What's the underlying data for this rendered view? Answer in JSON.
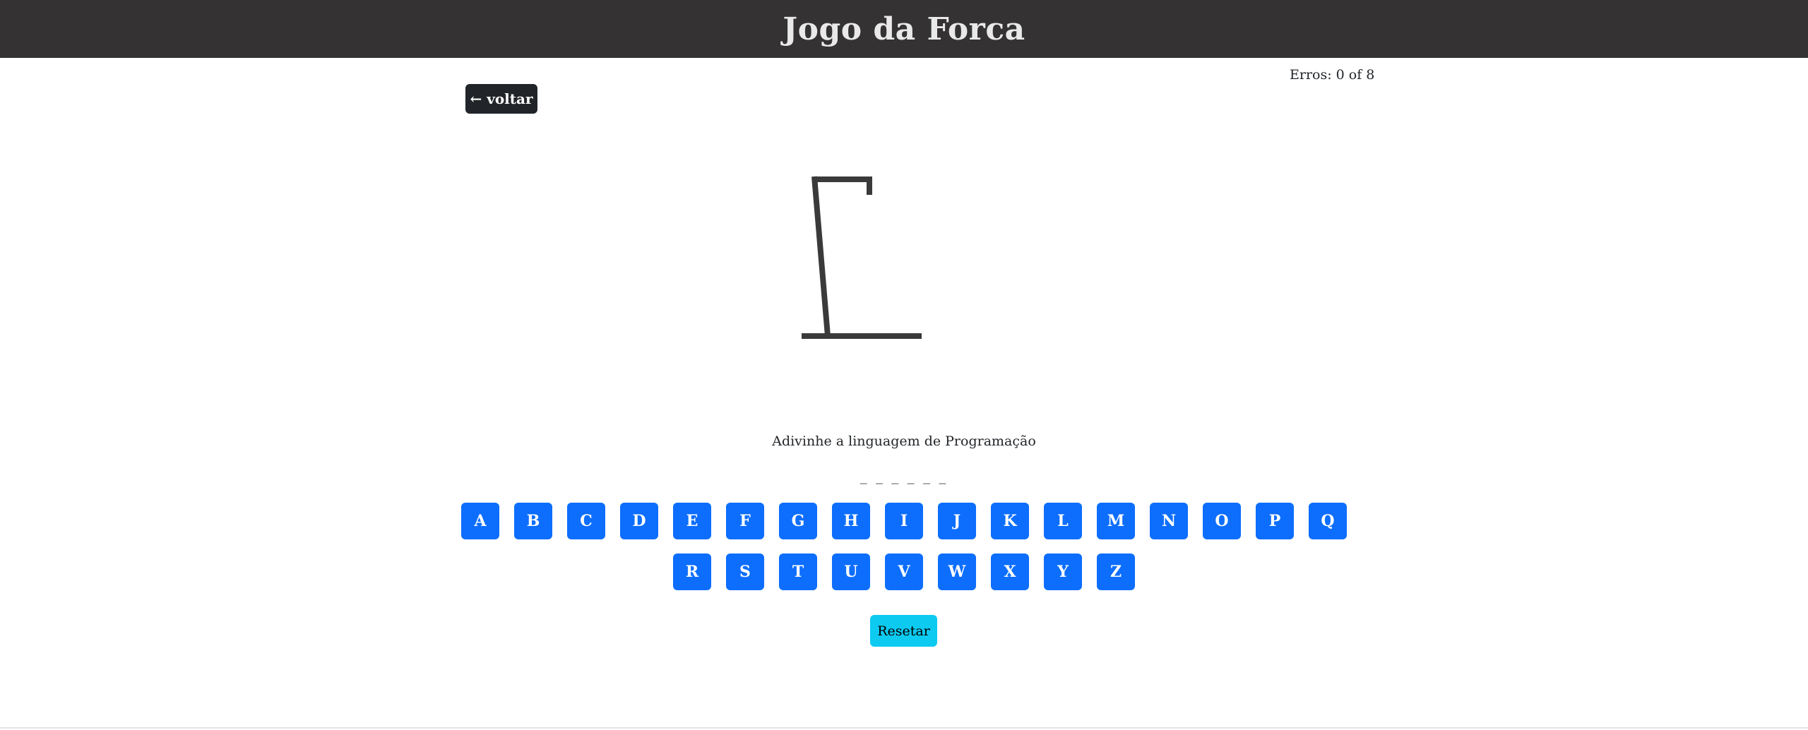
{
  "header": {
    "title": "Jogo da Forca"
  },
  "status": {
    "errors_text": "Erros: 0 of 8",
    "errors": 0,
    "max_errors": 8
  },
  "nav": {
    "back_label": "← voltar"
  },
  "game": {
    "prompt": "Adivinhe a linguagem de Programação",
    "word_display": "_ _ _ _ _ _",
    "word_length": 6
  },
  "keyboard": {
    "row1": [
      "A",
      "B",
      "C",
      "D",
      "E",
      "F",
      "G",
      "H",
      "I",
      "J",
      "K",
      "L",
      "M",
      "N",
      "O",
      "P",
      "Q"
    ],
    "row2": [
      "R",
      "S",
      "T",
      "U",
      "V",
      "W",
      "X",
      "Y",
      "Z"
    ]
  },
  "actions": {
    "reset_label": "Resetar"
  },
  "colors": {
    "header_bg": "#343233",
    "letter_button": "#0d6efd",
    "reset_button": "#0dcaf0",
    "back_button": "#212529",
    "gallows": "#3a3a3a"
  }
}
